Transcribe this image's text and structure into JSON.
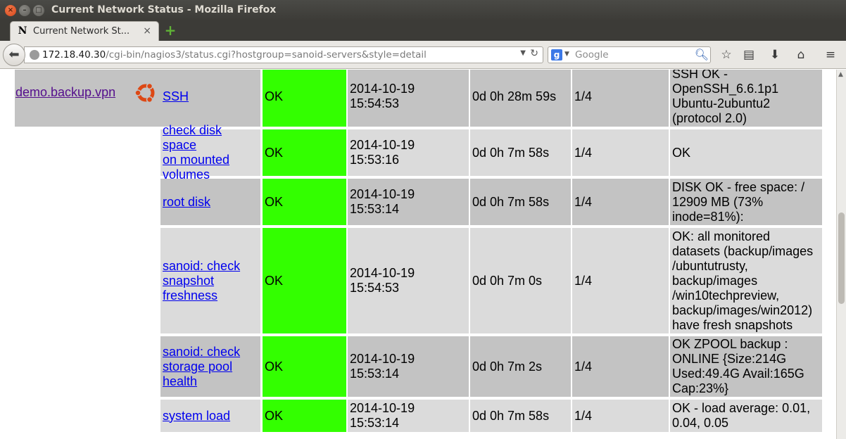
{
  "window": {
    "title": "Current Network Status - Mozilla Firefox"
  },
  "tab": {
    "label": "Current Network St...",
    "favicon": "N"
  },
  "navigation": {
    "url_host": "172.18.40.30",
    "url_path": "/cgi-bin/nagios3/status.cgi?hostgroup=sanoid-servers&style=detail",
    "search_placeholder": "Google"
  },
  "host": {
    "name": "demo.backup.vpn",
    "icon": "ubuntu-logo-icon"
  },
  "services": [
    {
      "name": "SSH",
      "status": "OK",
      "last_check": "2014-10-19 15:54:53",
      "duration": "0d 0h 28m 59s",
      "attempt": "1/4",
      "info": [
        "SSH OK -",
        "OpenSSH_6.6.1p1",
        "Ubuntu-2ubuntu2",
        "(protocol 2.0)"
      ]
    },
    {
      "name": [
        "check disk space",
        "on mounted",
        "volumes"
      ],
      "status": "OK",
      "last_check": "2014-10-19 15:53:16",
      "duration": "0d 0h 7m 58s",
      "attempt": "1/4",
      "info": [
        "OK"
      ]
    },
    {
      "name": "root disk",
      "status": "OK",
      "last_check": "2014-10-19 15:53:14",
      "duration": "0d 0h 7m 58s",
      "attempt": "1/4",
      "info": [
        "DISK OK - free space: /",
        "12909 MB (73%",
        "inode=81%):"
      ]
    },
    {
      "name": [
        "sanoid: check",
        "snapshot",
        "freshness"
      ],
      "status": "OK",
      "last_check": "2014-10-19 15:54:53",
      "duration": "0d 0h 7m 0s",
      "attempt": "1/4",
      "info": [
        "OK: all monitored",
        "datasets (backup/images",
        "/ubuntutrusty,",
        "backup/images",
        "/win10techpreview,",
        "backup/images/win2012)",
        "have fresh snapshots"
      ]
    },
    {
      "name": [
        "sanoid: check",
        "storage pool",
        "health"
      ],
      "status": "OK",
      "last_check": "2014-10-19 15:53:14",
      "duration": "0d 0h 7m 2s",
      "attempt": "1/4",
      "info": [
        "OK ZPOOL backup :",
        "ONLINE {Size:214G",
        "Used:49.4G Avail:165G",
        "Cap:23%}"
      ]
    },
    {
      "name": "system load",
      "status": "OK",
      "last_check": "2014-10-19 15:53:14",
      "duration": "0d 0h 7m 58s",
      "attempt": "1/4",
      "info": [
        "OK - load average: 0.01,",
        "0.04, 0.05"
      ]
    }
  ],
  "colors": {
    "ok": "#33ff00",
    "row_odd": "#c3c3c3",
    "row_even": "#dbdbdb",
    "link": "#0000ee",
    "visited_link": "#540d8c"
  }
}
